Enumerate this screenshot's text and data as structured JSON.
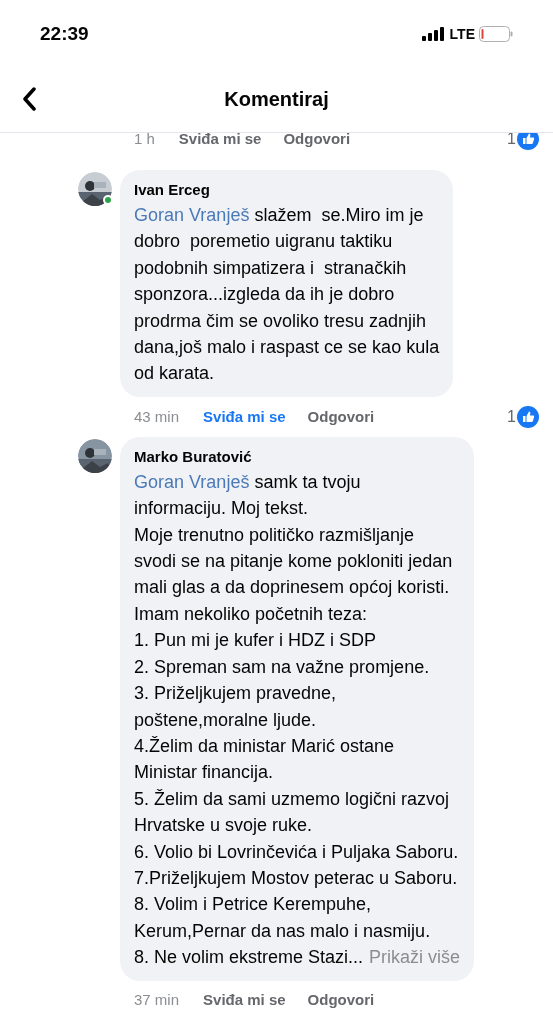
{
  "status_bar": {
    "time": "22:39",
    "network": "LTE"
  },
  "header": {
    "title": "Komentiraj"
  },
  "previous_footer": {
    "time": "1 h",
    "like_label": "Sviđa mi se",
    "liked": false,
    "reply_label": "Odgovori",
    "reactions": "1"
  },
  "comments": [
    {
      "author": "Ivan Erceg",
      "online": true,
      "mention": "Goran Vranješ",
      "lines": [
        " slažem  se.Miro im je",
        "dobro  poremetio uigranu taktiku",
        "podobnih simpatizera i  stranačkih",
        "sponzora...izgleda da ih je dobro",
        "prodrma čim se ovoliko tresu zadnjih",
        "dana,još malo i raspast ce se kao kula",
        "od karata."
      ],
      "time": "43 min",
      "like_label": "Sviđa mi se",
      "liked": true,
      "reply_label": "Odgovori",
      "reactions": "1"
    },
    {
      "author": "Marko Buratović",
      "online": false,
      "mention": "Goran Vranješ",
      "lines": [
        " samk ta tvoju",
        "informaciju. Moj tekst.",
        "Moje trenutno političko razmišljanje",
        "svodi se na pitanje kome pokloniti jedan",
        "mali glas a da doprinesem općoj koristi.",
        "Imam nekoliko početnih teza:",
        "1. Pun mi je kufer i HDZ i SDP",
        "2. Spreman sam na važne promjene.",
        "3. Priželjkujem pravedne,",
        "poštene,moralne ljude.",
        "4.Želim da ministar Marić ostane",
        "Ministar financija.",
        "5. Želim da sami uzmemo logični razvoj",
        "Hrvatske u svoje ruke.",
        "6. Volio bi Lovrinčevića i Puljaka Saboru.",
        "7.Priželjkujem Mostov peterac u Saboru.",
        "8. Volim i Petrice Kerempuhe,",
        "Kerum,Pernar da nas malo i nasmiju.",
        "8. Ne volim ekstreme Stazi..."
      ],
      "see_more": "Prikaži više",
      "time": "37 min",
      "like_label": "Sviđa mi se",
      "liked": false,
      "reply_label": "Odgovori"
    }
  ]
}
